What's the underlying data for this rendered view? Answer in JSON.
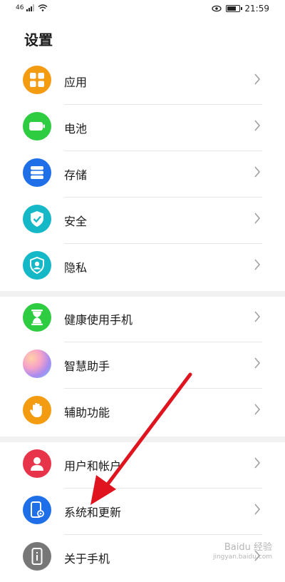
{
  "status": {
    "signal": "46",
    "time": "21:59",
    "battery_level": 0.8
  },
  "page_title": "设置",
  "groups": [
    [
      {
        "label": "应用",
        "icon": "apps-icon",
        "color": "#f39c12"
      },
      {
        "label": "电池",
        "icon": "battery-icon",
        "color": "#2ecc40"
      },
      {
        "label": "存储",
        "icon": "storage-icon",
        "color": "#1e6fe8"
      },
      {
        "label": "安全",
        "icon": "shield-check-icon",
        "color": "#14b8c6"
      },
      {
        "label": "隐私",
        "icon": "privacy-icon",
        "color": "#14b8c6"
      }
    ],
    [
      {
        "label": "健康使用手机",
        "icon": "hourglass-icon",
        "color": "#2ecc40"
      },
      {
        "label": "智慧助手",
        "icon": "assistant-icon",
        "color": "#b56ee0"
      },
      {
        "label": "辅助功能",
        "icon": "hand-icon",
        "color": "#f39c12"
      }
    ],
    [
      {
        "label": "用户和帐户",
        "icon": "user-icon",
        "color": "#e8344a"
      },
      {
        "label": "系统和更新",
        "icon": "system-update-icon",
        "color": "#1e6fe8"
      },
      {
        "label": "关于手机",
        "icon": "phone-info-icon",
        "color": "#777777"
      }
    ]
  ],
  "watermark": {
    "line1": "Baidu 经验",
    "line2": "jingyan.baidu.com"
  }
}
